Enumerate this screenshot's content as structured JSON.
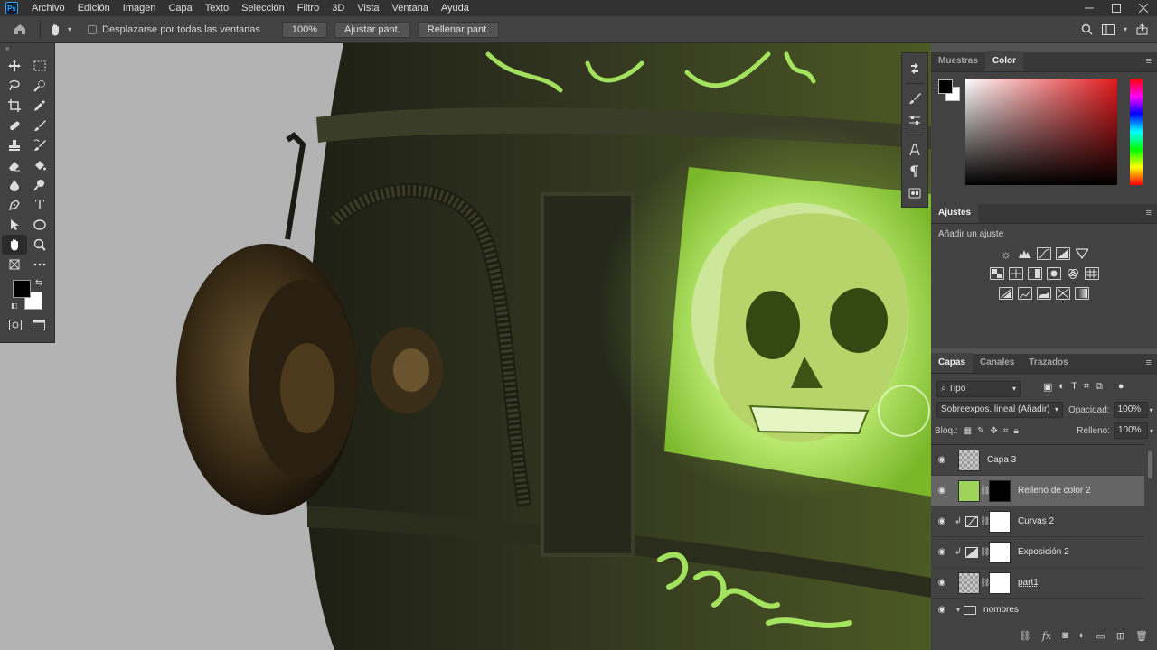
{
  "app": {
    "logo": "Ps"
  },
  "menu": [
    "Archivo",
    "Edición",
    "Imagen",
    "Capa",
    "Texto",
    "Selección",
    "Filtro",
    "3D",
    "Vista",
    "Ventana",
    "Ayuda"
  ],
  "options_bar": {
    "scroll_all_label": "Desplazarse por todas las ventanas",
    "zoom_value": "100%",
    "fit_screen_label": "Ajustar pant.",
    "fill_screen_label": "Rellenar pant."
  },
  "color_panel": {
    "tabs": [
      "Muestras",
      "Color"
    ],
    "active_tab": "Color",
    "foreground": "#000000",
    "background": "#ffffff",
    "hue_color": "#e4191c"
  },
  "adjustments_panel": {
    "title": "Ajustes",
    "add_label": "Añadir un ajuste"
  },
  "layers_panel": {
    "tabs": [
      "Capas",
      "Canales",
      "Trazados"
    ],
    "active_tab": "Capas",
    "filter_label": "Tipo",
    "blend_mode": "Sobreexpos. lineal (Añadir)",
    "opacity_label": "Opacidad:",
    "opacity_value": "100%",
    "lock_label": "Bloq.:",
    "fill_label": "Relleno:",
    "fill_value": "100%",
    "layers": [
      {
        "name": "Capa 3"
      },
      {
        "name": "Relleno de color 2"
      },
      {
        "name": "Curvas 2"
      },
      {
        "name": "Exposición 2"
      },
      {
        "name": "part1"
      },
      {
        "name": "nombres"
      }
    ]
  }
}
